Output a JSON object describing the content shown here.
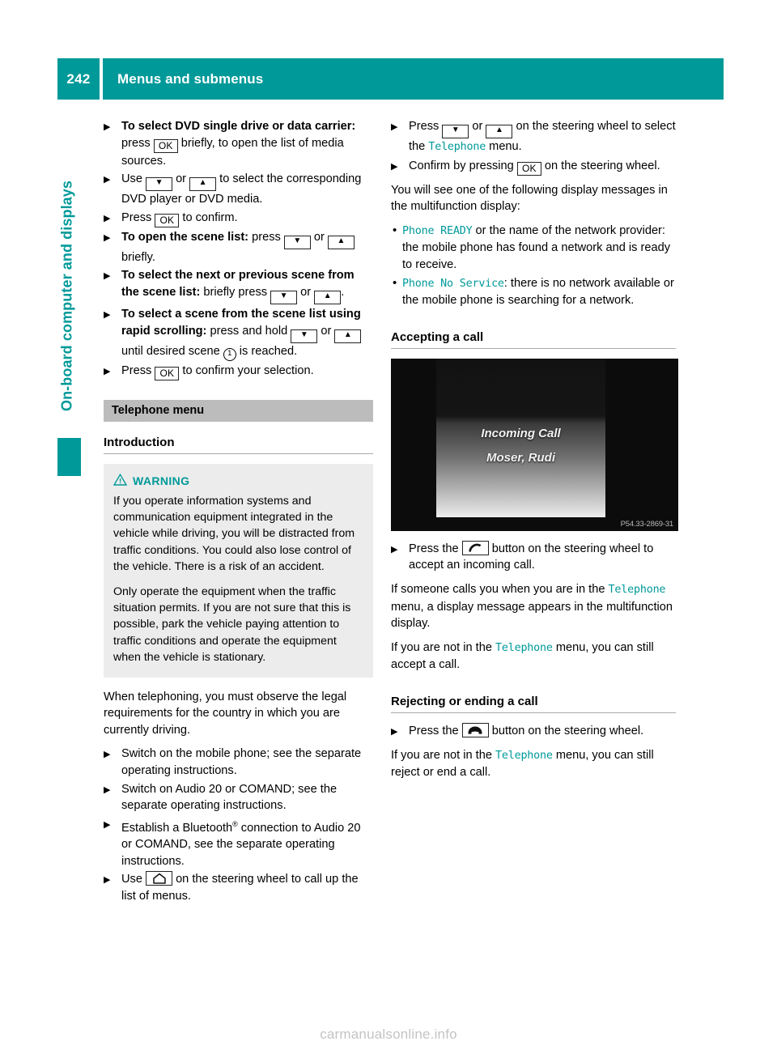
{
  "header": {
    "page_number": "242",
    "title": "Menus and submenus"
  },
  "sidebar": {
    "chapter_label": "On-board computer and displays",
    "accent_color": "#009999"
  },
  "icons": {
    "ok": "OK",
    "down": "▼",
    "up": "▲",
    "scene_ref": "1"
  },
  "left_column": {
    "steps": [
      {
        "lead": "To select DVD single drive or data carrier:",
        "t1": " press ",
        "key1": "OK",
        "t2": " briefly, to open the list of media sources."
      },
      {
        "t1": "Use ",
        "key1": "▼",
        "t2": " or ",
        "key2": "▲",
        "t3": " to select the corresponding DVD player or DVD media."
      },
      {
        "t1": "Press ",
        "key1": "OK",
        "t2": " to confirm."
      },
      {
        "lead": "To open the scene list:",
        "t1": " press ",
        "key1": "▼",
        "t2": " or ",
        "key2": "▲",
        "t3": " briefly."
      },
      {
        "lead": "To select the next or previous scene from the scene list:",
        "t1": " briefly press ",
        "key1": "▼",
        "t2": " or ",
        "key2": "▲",
        "t3": "."
      },
      {
        "lead": "To select a scene from the scene list using rapid scrolling:",
        "t1": " press and hold ",
        "key1": "▼",
        "t2": " or ",
        "key2": "▲",
        "t3": " until desired scene ",
        "circled": "1",
        "t4": " is reached."
      },
      {
        "t1": "Press ",
        "key1": "OK",
        "t2": " to confirm your selection."
      }
    ],
    "section_bar": "Telephone menu",
    "subsection": "Introduction",
    "warning": {
      "label": "WARNING",
      "icon": "warning-triangle",
      "paragraph_1": "If you operate information systems and communication equipment integrated in the vehicle while driving, you will be distracted from traffic conditions. You could also lose control of the vehicle. There is a risk of an accident.",
      "paragraph_2": "Only operate the equipment when the traffic situation permits. If you are not sure that this is possible, park the vehicle paying attention to traffic conditions and operate the equipment when the vehicle is stationary."
    },
    "intro_paragraph": "When telephoning, you must observe the legal requirements for the country in which you are currently driving.",
    "steps2": [
      {
        "t1": "Switch on the mobile phone; see the separate operating instructions."
      },
      {
        "t1": "Switch on Audio 20 or COMAND; see the separate operating instructions."
      },
      {
        "t1": "Establish a Bluetooth",
        "sup": "®",
        "t2": " connection to Audio 20 or COMAND, see the separate operating instructions."
      },
      {
        "t1": "Use ",
        "key1": "home",
        "t2": " on the steering wheel to call up the list of menus."
      }
    ]
  },
  "right_column": {
    "steps": [
      {
        "t1": "Press ",
        "key1": "▼",
        "t2": " or ",
        "key2": "▲",
        "t3": " on the steering wheel to select the ",
        "mono": "Telephone",
        "t4": " menu."
      },
      {
        "t1": "Confirm by pressing ",
        "key1": "OK",
        "t2": " on the steering wheel."
      }
    ],
    "paragraph_1": "You will see one of the following display messages in the multifunction display:",
    "bullets": [
      {
        "mono": "Phone READY",
        "text": " or the name of the network provider: the mobile phone has found a network and is ready to receive."
      },
      {
        "mono": "Phone No Service",
        "text": ": there is no network available or the mobile phone is searching for a network."
      }
    ],
    "accepting_head": "Accepting a call",
    "figure": {
      "line1": "Incoming Call",
      "line2": "Moser, Rudi",
      "code": "P54.33-2869-31"
    },
    "accept_step": {
      "t1": "Press the ",
      "key1": "accept-call",
      "t2": " button on the steering wheel to accept an incoming call."
    },
    "paragraph_2_a": "If someone calls you when you are in the ",
    "paragraph_2_mono": "Telephone",
    "paragraph_2_b": " menu, a display message appears in the multifunction display.",
    "paragraph_3_a": "If you are not in the ",
    "paragraph_3_mono": "Telephone",
    "paragraph_3_b": " menu, you can still accept a call.",
    "rejecting_head": "Rejecting or ending a call",
    "reject_step": {
      "t1": "Press the ",
      "key1": "end-call",
      "t2": " button on the steering wheel."
    },
    "paragraph_4_a": "If you are not in the ",
    "paragraph_4_mono": "Telephone",
    "paragraph_4_b": " menu, you can still reject or end a call."
  },
  "footer": {
    "watermark": "carmanualsonline.info"
  }
}
